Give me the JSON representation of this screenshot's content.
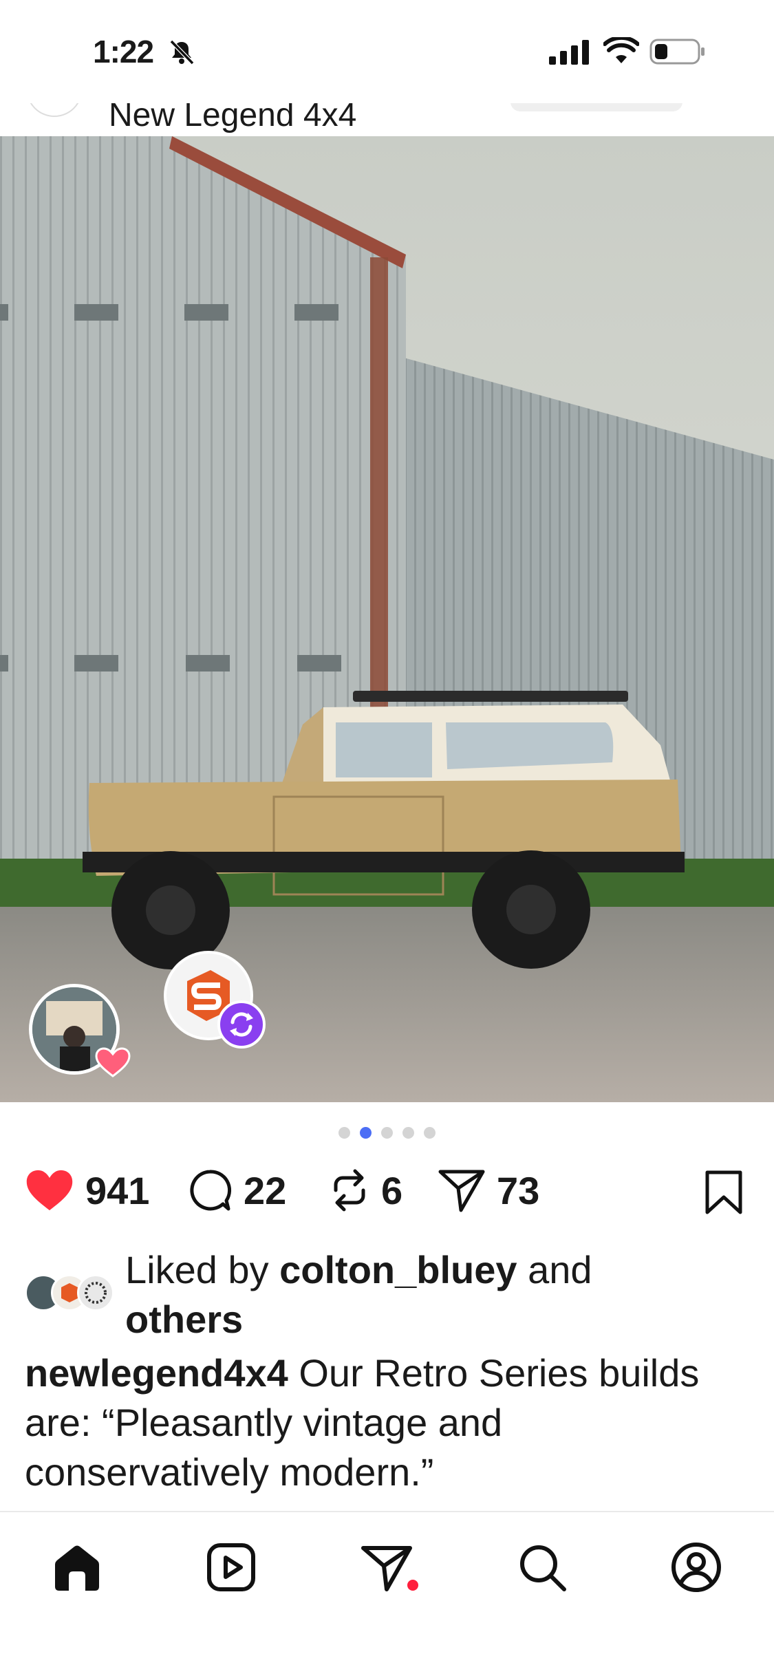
{
  "status_bar": {
    "time": "1:22"
  },
  "post": {
    "account_name": "New Legend 4x4",
    "image_count_dots": 5,
    "active_dot_index": 1
  },
  "actions": {
    "likes": "941",
    "comments": "22",
    "reposts": "6",
    "shares": "73"
  },
  "likes": {
    "prefix": "Liked by ",
    "user": "colton_bluey",
    "middle": " and",
    "others": "others"
  },
  "caption": {
    "username": "newlegend4x4",
    "text": " Our Retro Series builds are: “Pleasantly vintage and conservatively modern.”"
  },
  "colors": {
    "like_red": "#ff3040",
    "active_dot": "#4c6ef5",
    "repost_badge": "#8a3ff0",
    "notification_dot": "#ff1f3d"
  },
  "nav": {
    "items": [
      "home-icon",
      "reels-icon",
      "messages-icon",
      "search-icon",
      "profile-icon"
    ]
  }
}
